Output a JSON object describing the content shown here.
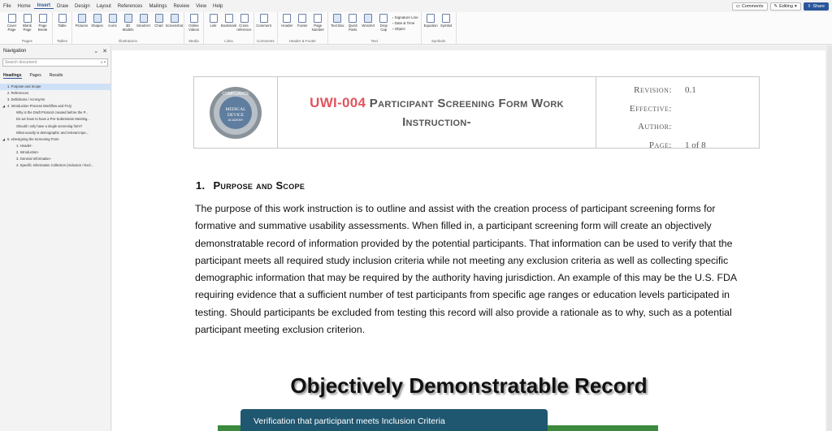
{
  "menu": {
    "items": [
      "File",
      "Home",
      "Insert",
      "Draw",
      "Design",
      "Layout",
      "References",
      "Mailings",
      "Review",
      "View",
      "Help"
    ],
    "active_index": 2,
    "comments": "Comments",
    "editing": "Editing",
    "share": "Share"
  },
  "ribbon": {
    "groups": [
      {
        "label": "Pages",
        "buttons": [
          "Cover Page",
          "Blank Page",
          "Page Break"
        ]
      },
      {
        "label": "Tables",
        "buttons": [
          "Table"
        ]
      },
      {
        "label": "Illustrations",
        "buttons": [
          "Pictures",
          "Shapes",
          "Icons",
          "3D Models",
          "SmartArt",
          "Chart",
          "Screenshot"
        ]
      },
      {
        "label": "Media",
        "buttons": [
          "Online Videos"
        ]
      },
      {
        "label": "Links",
        "buttons": [
          "Link",
          "Bookmark",
          "Cross-reference"
        ]
      },
      {
        "label": "Comments",
        "buttons": [
          "Comment"
        ]
      },
      {
        "label": "Header & Footer",
        "buttons": [
          "Header",
          "Footer",
          "Page Number"
        ]
      },
      {
        "label": "Text",
        "buttons": [
          "Text Box",
          "Quick Parts",
          "WordArt",
          "Drop Cap"
        ],
        "mini": [
          "Signature Line",
          "Date & Time",
          "Object"
        ]
      },
      {
        "label": "Symbols",
        "buttons": [
          "Equation",
          "Symbol"
        ]
      }
    ]
  },
  "navigation": {
    "title": "Navigation",
    "search_placeholder": "Search document",
    "tabs": [
      "Headings",
      "Pages",
      "Results"
    ],
    "items": [
      {
        "text": "1. Purpose and Scope",
        "level": 1,
        "selected": true
      },
      {
        "text": "2. References",
        "level": 1
      },
      {
        "text": "3. Definitions / Acronyms",
        "level": 1
      },
      {
        "text": "4. Introduction Process Workflow and FAQ",
        "level": 1,
        "caret": true
      },
      {
        "text": "Why is the Draft Protocol created before the P...",
        "level": 2
      },
      {
        "text": "Do we have to have a Pre-Submission Meeting...",
        "level": 2
      },
      {
        "text": "Should I only have a single screening form?",
        "level": 2
      },
      {
        "text": "What exactly is demographic and relevant spe...",
        "level": 2
      },
      {
        "text": "5. eDesigning the Screening Form",
        "level": 1,
        "caret": true
      },
      {
        "text": "1. Header-",
        "level": 2
      },
      {
        "text": "2. Introduction-",
        "level": 2
      },
      {
        "text": "3. General Information-",
        "level": 2
      },
      {
        "text": "4. Specific Information Collection (Inclusion / Excl...",
        "level": 2
      }
    ]
  },
  "document": {
    "header": {
      "logo_text": [
        "COMPLIANCE",
        "MEDICAL",
        "DEVICE",
        "ACADEMY",
        "EDUCATION",
        "RESOURCES"
      ],
      "code": "UWI-004",
      "title": "Participant Screening Form Work Instruction-",
      "meta": [
        {
          "key": "Revision:",
          "value": "0.1"
        },
        {
          "key": "Effective:",
          "value": ""
        },
        {
          "key": "Author:",
          "value": ""
        },
        {
          "key": "Page:",
          "value": "1 of 8"
        }
      ]
    },
    "section_number": "1.",
    "section_title": "Purpose and Scope",
    "body": "The purpose of this work instruction is to outline and assist with the creation process of participant screening forms for formative and summative usability assessments. When filled in, a participant screening form will create an objectively demonstratable record of information provided by the potential participants. That information can be used to verify that the participant meets all required study inclusion criteria while not meeting any exclusion criteria as well as collecting specific demographic information that may be required by the authority having jurisdiction. An example of this may be the U.S. FDA requiring evidence that a sufficient number of test participants from specific age ranges or education levels participated in testing. Should participants be excluded from testing this record will also provide a rationale as to why, such as a potential participant meeting exclusion criterion.",
    "graphic_title": "Objectively Demonstratable Record",
    "graphic_box": "Verification that participant meets Inclusion Criteria"
  },
  "colors": {
    "accent": "#2b579a",
    "code": "#e0555f",
    "teal": "#1f5670",
    "green": "#3b8a3e"
  }
}
